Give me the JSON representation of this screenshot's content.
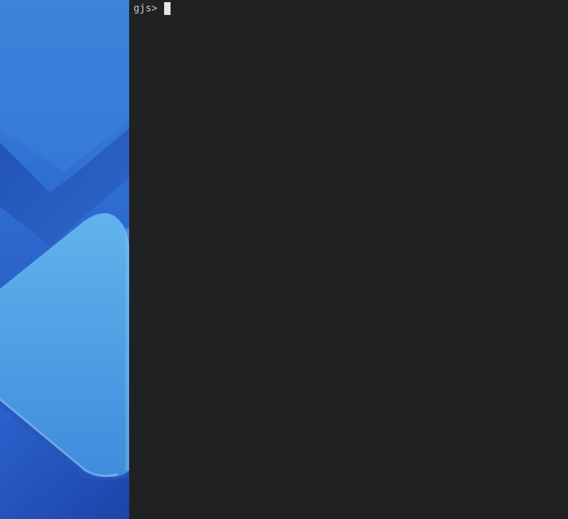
{
  "terminal": {
    "prompt": "gjs>",
    "input": ""
  },
  "colors": {
    "terminal_background": "#1f2122",
    "terminal_text": "#c8cbcc",
    "cursor": "#e4e6e6",
    "wallpaper_primary": "#3a7fd6",
    "wallpaper_light": "#5aaee6",
    "wallpaper_dark": "#1f4aa8"
  }
}
